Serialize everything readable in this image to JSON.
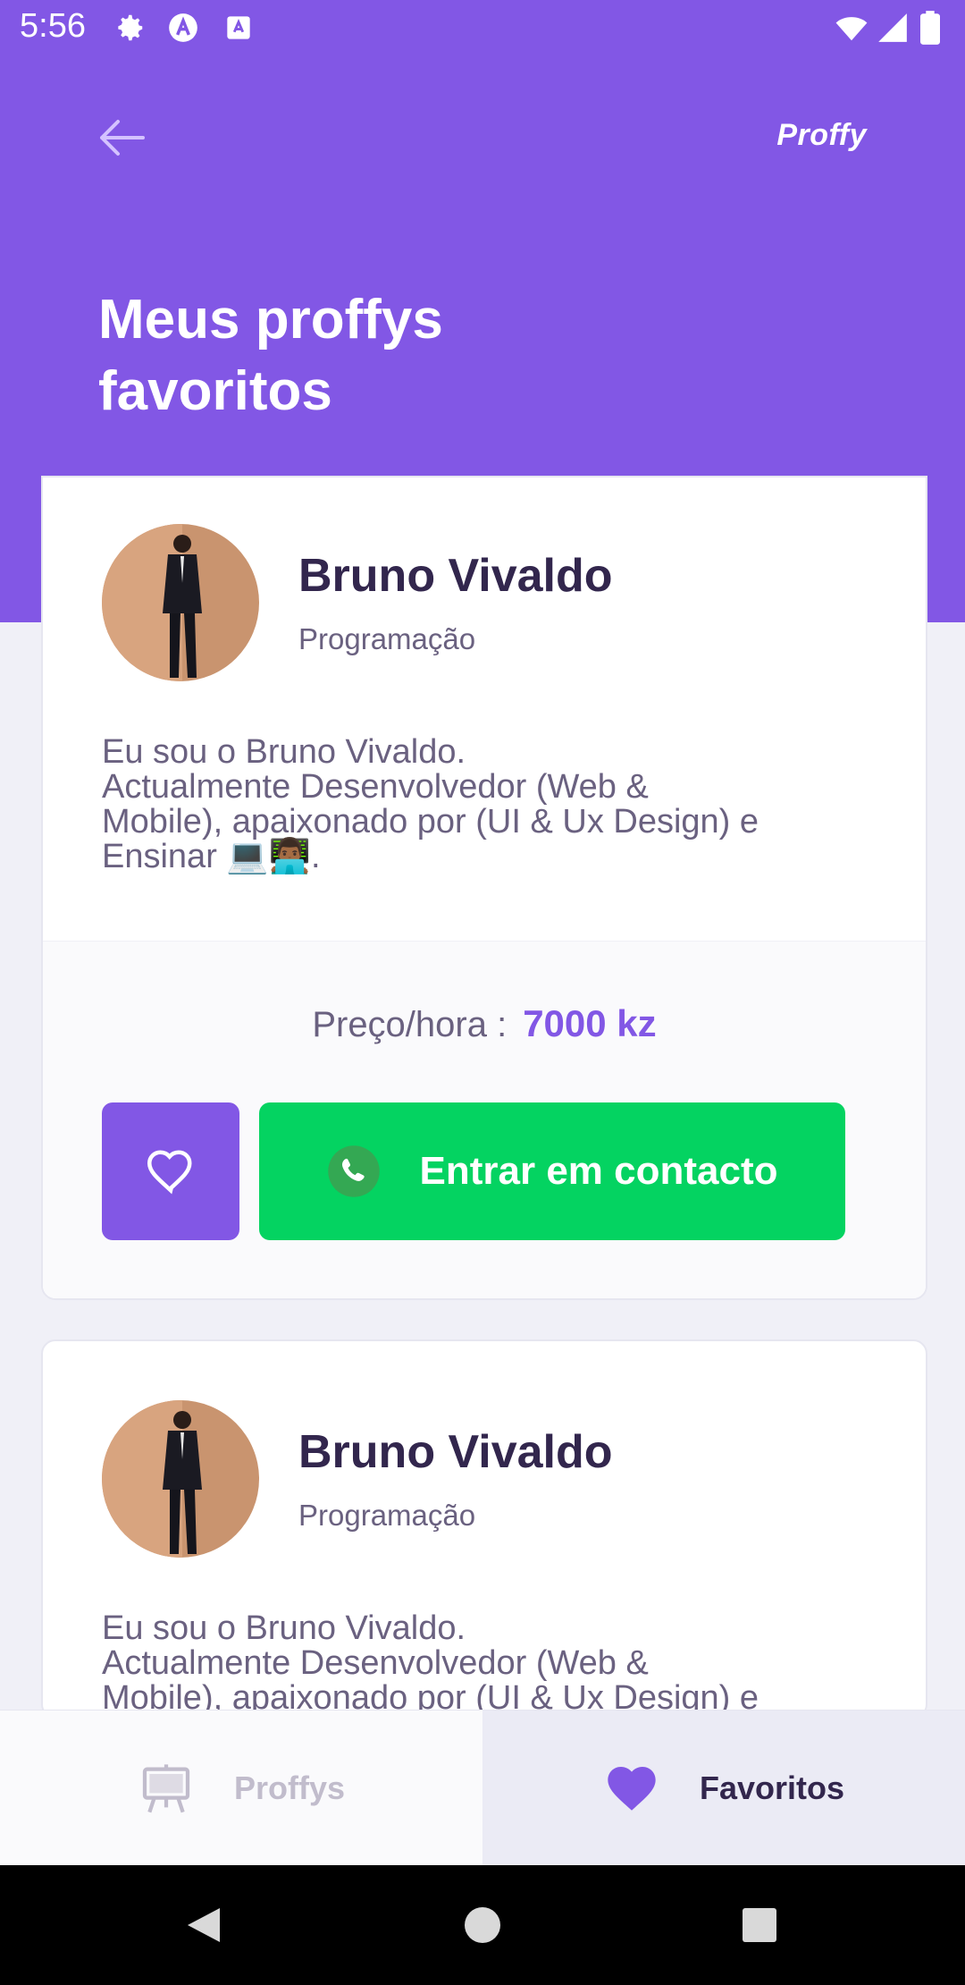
{
  "status_bar": {
    "time": "5:56"
  },
  "header": {
    "brand": "Proffy",
    "title": "Meus proffys favoritos"
  },
  "teachers": [
    {
      "name": "Bruno Vivaldo",
      "subject": "Programação",
      "bio": "Eu sou o Bruno Vivaldo.\nActualmente Desenvolvedor (Web &\nMobile), apaixonado por (UI & Ux Design) e\nEnsinar 💻👨🏾‍💻.",
      "price_label": "Preço/hora :",
      "price_value": "7000 kz",
      "contact_label": "Entrar em contacto",
      "favorited": true
    },
    {
      "name": "Bruno Vivaldo",
      "subject": "Programação",
      "bio": "Eu sou o Bruno Vivaldo.\nActualmente Desenvolvedor (Web &\nMobile), apaixonado por (UI & Ux Design) e"
    }
  ],
  "tabs": [
    {
      "label": "Proffys",
      "icon": "easel-icon",
      "active": false
    },
    {
      "label": "Favoritos",
      "icon": "heart-icon",
      "active": true
    }
  ],
  "colors": {
    "primary": "#8257e5",
    "secondary": "#04d361",
    "background": "#f0f0f7",
    "title": "#32264d",
    "text": "#6a6180"
  }
}
